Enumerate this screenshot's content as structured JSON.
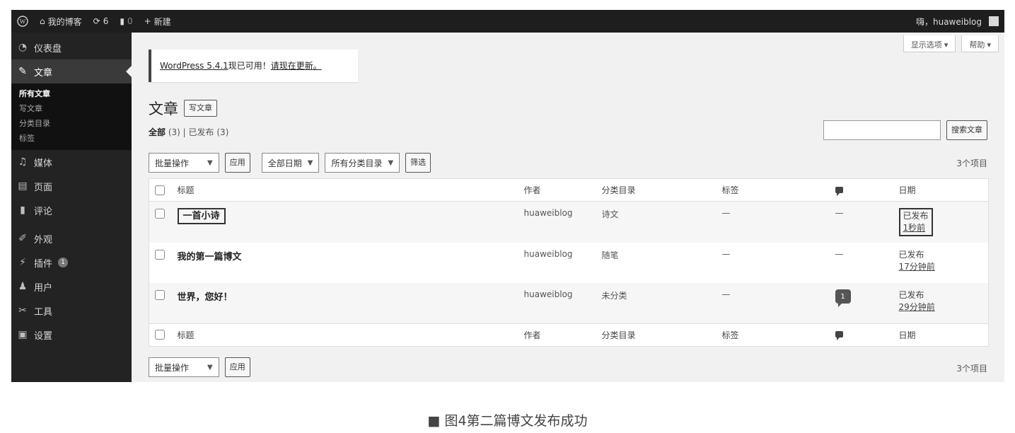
{
  "admin_bar": {
    "wp_logo": "wordpress-logo-icon",
    "site_name": "我的博客",
    "updates_count": "6",
    "comments_count": "0",
    "new_label": "新建",
    "greeting": "嗨，huaweiblog"
  },
  "sidebar": {
    "items": [
      {
        "icon": "dashboard-icon",
        "label": "仪表盘"
      },
      {
        "icon": "pin-icon",
        "label": "文章"
      },
      {
        "icon": "media-icon",
        "label": "媒体"
      },
      {
        "icon": "page-icon",
        "label": "页面"
      },
      {
        "icon": "comment-icon",
        "label": "评论"
      },
      {
        "icon": "brush-icon",
        "label": "外观"
      },
      {
        "icon": "plugin-icon",
        "label": "插件",
        "badge": "1"
      },
      {
        "icon": "user-icon",
        "label": "用户"
      },
      {
        "icon": "wrench-icon",
        "label": "工具"
      },
      {
        "icon": "settings-icon",
        "label": "设置"
      }
    ],
    "posts_submenu": [
      "所有文章",
      "写文章",
      "分类目录",
      "标签"
    ]
  },
  "screen_options": {
    "screen": "显示选项",
    "help": "帮助"
  },
  "notice": {
    "link": "WordPress 5.4.1",
    "text": "现已可用！",
    "update_link": "请现在更新。"
  },
  "page": {
    "title": "文章",
    "add_new": "写文章"
  },
  "filters": {
    "all_label": "全部",
    "all_count": "(3)",
    "published_label": "已发布",
    "published_count": "(3)",
    "bulk_action": "批量操作",
    "apply": "应用",
    "all_dates": "全部日期",
    "all_categories": "所有分类目录",
    "filter": "筛选",
    "item_count": "3个项目"
  },
  "search": {
    "button": "搜索文章",
    "value": ""
  },
  "table": {
    "columns": {
      "title": "标题",
      "author": "作者",
      "categories": "分类目录",
      "tags": "标签",
      "date": "日期"
    },
    "rows": [
      {
        "title": "一首小诗",
        "author": "huaweiblog",
        "category": "诗文",
        "tags": "—",
        "comments": "—",
        "status": "已发布",
        "date": "1秒前"
      },
      {
        "title": "我的第一篇博文",
        "author": "huaweiblog",
        "category": "随笔",
        "tags": "—",
        "comments": "—",
        "status": "已发布",
        "date": "17分钟前"
      },
      {
        "title": "世界，您好！",
        "author": "huaweiblog",
        "category": "未分类",
        "tags": "—",
        "comments": "1",
        "status": "已发布",
        "date": "29分钟前"
      }
    ]
  },
  "caption": "■ 图4第二篇博文发布成功"
}
